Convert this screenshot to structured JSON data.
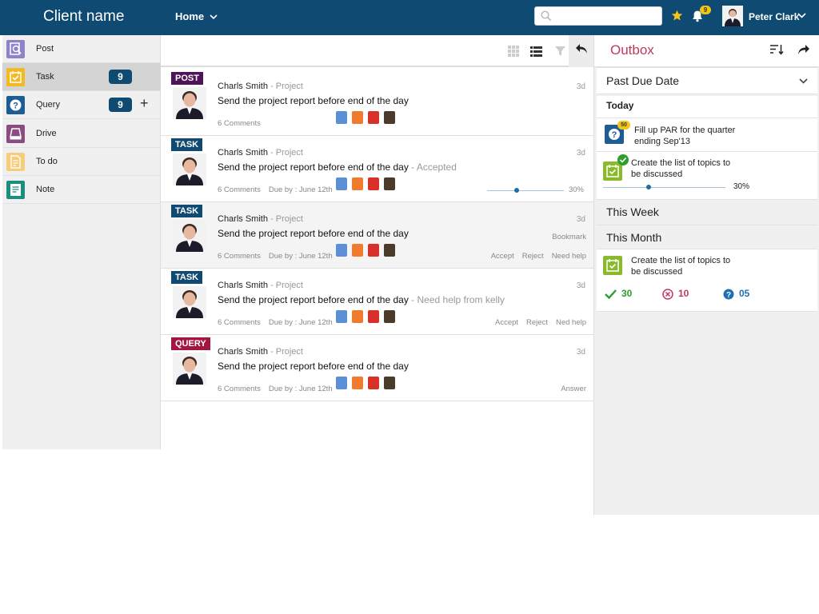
{
  "header": {
    "brand": "Client name",
    "home_label": "Home",
    "search_placeholder": "",
    "notification_count": "9",
    "user_name": "Peter Clark"
  },
  "sidebar": {
    "items": [
      {
        "label": "Post",
        "icon": "post-icon",
        "color": "#8d83c9"
      },
      {
        "label": "Task",
        "icon": "task-icon",
        "color": "#f3b922",
        "count": "9"
      },
      {
        "label": "Query",
        "icon": "query-icon",
        "color": "#1e5c95",
        "count": "9"
      },
      {
        "label": "Drive",
        "icon": "drive-icon",
        "color": "#8b4d7f"
      },
      {
        "label": "To do",
        "icon": "todo-icon",
        "color": "#f8cd79"
      },
      {
        "label": "Note",
        "icon": "note-icon",
        "color": "#1a8f7d"
      }
    ]
  },
  "feed": {
    "items": [
      {
        "type": "POST",
        "type_color": "#4d1459",
        "author": "Charls Smith",
        "project": "- Project",
        "title": "Send the project report before end of the day",
        "status": "",
        "time": "3d",
        "comments": "6 Comments",
        "due": ""
      },
      {
        "type": "TASK",
        "type_color": "#0f4a72",
        "author": "Charls Smith",
        "project": "- Project",
        "title": "Send the project report before end of the day",
        "status": "- Accepted",
        "time": "3d",
        "comments": "6 Comments",
        "due": "Due by : June 12th",
        "progress": 0.35,
        "progress_label": "30%"
      },
      {
        "type": "TASK",
        "type_color": "#0f4a72",
        "author": "Charls Smith",
        "project": "- Project",
        "title": "Send the project report before end of the day",
        "status": "",
        "time": "3d",
        "comments": "6 Comments",
        "due": "Due by : June 12th",
        "bookmark": "Bookmark",
        "actions": [
          "Accept",
          "Reject",
          "Need help"
        ]
      },
      {
        "type": "TASK",
        "type_color": "#0f4a72",
        "author": "Charls Smith",
        "project": "- Project",
        "title": "Send the project report before end of the day",
        "status": "- Need help from kelly",
        "time": "3d",
        "comments": "6 Comments",
        "due": "Due by : June 12th",
        "actions": [
          "Accept",
          "Reject",
          "Ned help"
        ]
      },
      {
        "type": "QUERY",
        "type_color": "#a3163f",
        "author": "Charls Smith",
        "project": "- Project",
        "title": "Send the project report before end of the day",
        "status": "",
        "time": "3d",
        "comments": "6 Comments",
        "due": "Due by : June 12th",
        "actions": [
          "Answer"
        ]
      }
    ]
  },
  "outbox": {
    "title": "Outbox",
    "filter": "Past Due Date",
    "today_label": "Today",
    "today_items": [
      {
        "text1": "Fill up PAR for the quarter",
        "text2": "ending Sep'13",
        "badge": "50"
      },
      {
        "text1": "Create the list of topics to",
        "text2": "be discussed",
        "progress": 0.35,
        "progress_label": "30%"
      }
    ],
    "this_week": "This Week",
    "this_month": "This Month",
    "month_item": {
      "text1": "Create the list of topics to",
      "text2": "be discussed"
    },
    "stats": {
      "accepted": "30",
      "rejected": "10",
      "queries": "05"
    },
    "colors": {
      "accent": "#c0395b",
      "green": "#2e9e2e",
      "red": "#c0395b",
      "blue": "#1e6fb5"
    }
  }
}
